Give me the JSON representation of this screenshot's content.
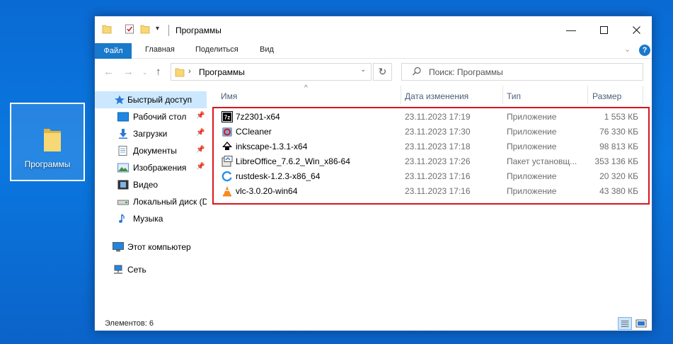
{
  "desktop": {
    "icon_label": "Программы"
  },
  "window": {
    "title": "Программы",
    "ribbon_tabs": [
      "Файл",
      "Главная",
      "Поделиться",
      "Вид"
    ],
    "help_label": "?"
  },
  "address": {
    "crumb": "Программы",
    "search_placeholder": "Поиск: Программы"
  },
  "nav_pane": {
    "items": [
      {
        "label": "Быстрый доступ",
        "icon": "star-icon"
      },
      {
        "label": "Рабочий стол",
        "icon": "desktop-icon"
      },
      {
        "label": "Загрузки",
        "icon": "download-icon"
      },
      {
        "label": "Документы",
        "icon": "documents-icon"
      },
      {
        "label": "Изображения",
        "icon": "images-icon"
      },
      {
        "label": "Видео",
        "icon": "video-icon"
      },
      {
        "label": "Локальный диск (D",
        "icon": "drive-icon"
      },
      {
        "label": "Музыка",
        "icon": "music-icon"
      },
      {
        "label": "Этот компьютер",
        "icon": "computer-icon"
      },
      {
        "label": "Сеть",
        "icon": "network-icon"
      }
    ]
  },
  "file_list": {
    "columns": [
      "Имя",
      "Дата изменения",
      "Тип",
      "Размер"
    ],
    "rows": [
      {
        "name": "7z2301-x64",
        "date": "23.11.2023 17:19",
        "type": "Приложение",
        "size": "1 553 КБ",
        "icon": "7zip-icon"
      },
      {
        "name": "CCleaner",
        "date": "23.11.2023 17:30",
        "type": "Приложение",
        "size": "76 330 КБ",
        "icon": "ccleaner-icon"
      },
      {
        "name": "inkscape-1.3.1-x64",
        "date": "23.11.2023 17:18",
        "type": "Приложение",
        "size": "98 813 КБ",
        "icon": "inkscape-icon"
      },
      {
        "name": "LibreOffice_7.6.2_Win_x86-64",
        "date": "23.11.2023 17:26",
        "type": "Пакет установщ...",
        "size": "353 136 КБ",
        "icon": "installer-package-icon"
      },
      {
        "name": "rustdesk-1.2.3-x86_64",
        "date": "23.11.2023 17:16",
        "type": "Приложение",
        "size": "20 320 КБ",
        "icon": "rustdesk-icon"
      },
      {
        "name": "vlc-3.0.20-win64",
        "date": "23.11.2023 17:16",
        "type": "Приложение",
        "size": "43 380 КБ",
        "icon": "vlc-icon"
      }
    ]
  },
  "status": {
    "items_count": "Элементов: 6"
  },
  "colors": {
    "accent": "#1979ca",
    "highlight": "#d7161f",
    "selected_nav": "#cce8ff",
    "desktop_bg": "#0a78e0"
  }
}
